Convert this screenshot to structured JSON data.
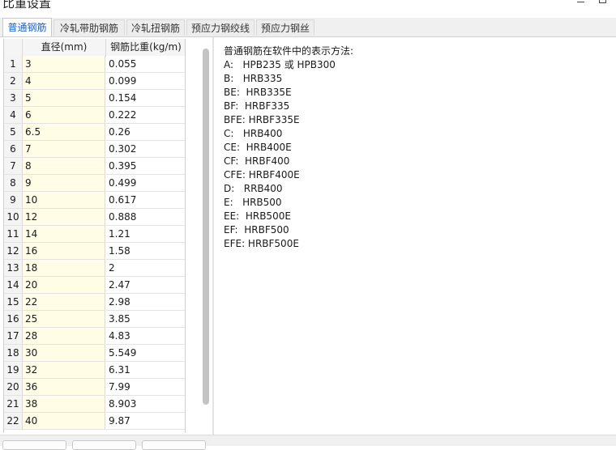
{
  "window": {
    "title": "比重设置"
  },
  "tabs": [
    {
      "label": "普通钢筋",
      "active": true
    },
    {
      "label": "冷轧带肋钢筋",
      "active": false
    },
    {
      "label": "冷轧扭钢筋",
      "active": false
    },
    {
      "label": "预应力钢绞线",
      "active": false
    },
    {
      "label": "预应力钢丝",
      "active": false
    }
  ],
  "table": {
    "columns": [
      "直径(mm)",
      "钢筋比重(kg/m)"
    ],
    "rows": [
      {
        "index": "1",
        "diameter": "3",
        "weight": "0.055"
      },
      {
        "index": "2",
        "diameter": "4",
        "weight": "0.099"
      },
      {
        "index": "3",
        "diameter": "5",
        "weight": "0.154"
      },
      {
        "index": "4",
        "diameter": "6",
        "weight": "0.222"
      },
      {
        "index": "5",
        "diameter": "6.5",
        "weight": "0.26"
      },
      {
        "index": "6",
        "diameter": "7",
        "weight": "0.302"
      },
      {
        "index": "7",
        "diameter": "8",
        "weight": "0.395"
      },
      {
        "index": "8",
        "diameter": "9",
        "weight": "0.499"
      },
      {
        "index": "9",
        "diameter": "10",
        "weight": "0.617"
      },
      {
        "index": "10",
        "diameter": "12",
        "weight": "0.888"
      },
      {
        "index": "11",
        "diameter": "14",
        "weight": "1.21"
      },
      {
        "index": "12",
        "diameter": "16",
        "weight": "1.58"
      },
      {
        "index": "13",
        "diameter": "18",
        "weight": "2"
      },
      {
        "index": "14",
        "diameter": "20",
        "weight": "2.47"
      },
      {
        "index": "15",
        "diameter": "22",
        "weight": "2.98"
      },
      {
        "index": "16",
        "diameter": "25",
        "weight": "3.85"
      },
      {
        "index": "17",
        "diameter": "28",
        "weight": "4.83"
      },
      {
        "index": "18",
        "diameter": "30",
        "weight": "5.549"
      },
      {
        "index": "19",
        "diameter": "32",
        "weight": "6.31"
      },
      {
        "index": "20",
        "diameter": "36",
        "weight": "7.99"
      },
      {
        "index": "21",
        "diameter": "38",
        "weight": "8.903"
      },
      {
        "index": "22",
        "diameter": "40",
        "weight": "9.87"
      }
    ]
  },
  "notes": {
    "heading": "普通钢筋在软件中的表示方法:",
    "lines": [
      "A:   HPB235 或 HPB300",
      "B:   HRB335",
      "BE:  HRB335E",
      "BF:  HRBF335",
      "BFE: HRBF335E",
      "C:   HRB400",
      "CE:  HRB400E",
      "CF:  HRBF400",
      "CFE: HRBF400E",
      "D:   RRB400",
      "E:   HRB500",
      "EE:  HRB500E",
      "EF:  HRBF500",
      "EFE: HRBF500E"
    ]
  },
  "icons": {
    "minimize": "minimize-icon",
    "maximize": "maximize-icon"
  }
}
